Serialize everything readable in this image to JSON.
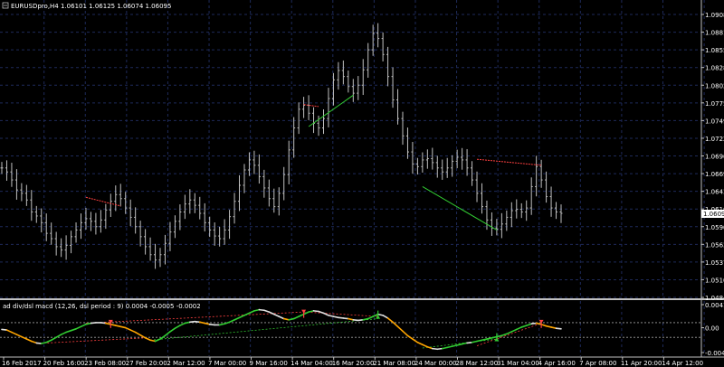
{
  "chart_data": {
    "type": "candlestick",
    "symbol_header": "EURUSDpro,H4  1.06101 1.06125 1.06074 1.06095",
    "current_price": "1.06095",
    "price_axis_ticks": [
      "1.09080",
      "1.08815",
      "1.08550",
      "1.08285",
      "1.08020",
      "1.07755",
      "1.07490",
      "1.07225",
      "1.06960",
      "1.06695",
      "1.06430",
      "1.06165",
      "1.05900",
      "1.05635",
      "1.05370",
      "1.05105",
      "1.04840"
    ],
    "time_axis_labels": [
      "16 Feb 2017",
      "20 Feb 16:00",
      "23 Feb 08:00",
      "27 Feb 20:00",
      "2 Mar 12:00",
      "7 Mar 00:00",
      "9 Mar 16:00",
      "14 Mar 04:00",
      "16 Mar 20:00",
      "21 Mar 08:00",
      "24 Mar 00:00",
      "28 Mar 12:00",
      "31 Mar 04:00",
      "4 Apr 16:00",
      "7 Apr 08:00",
      "11 Apr 20:00",
      "14 Apr 12:00"
    ],
    "price_series_close": [
      1.0678,
      1.0672,
      1.066,
      1.0645,
      1.064,
      1.063,
      1.0612,
      1.0606,
      1.0596,
      1.058,
      1.0572,
      1.056,
      1.0555,
      1.0562,
      1.0575,
      1.0585,
      1.0596,
      1.0602,
      1.0598,
      1.059,
      1.06,
      1.0615,
      1.0628,
      1.0638,
      1.0632,
      1.0618,
      1.0604,
      1.059,
      1.0575,
      1.056,
      1.0548,
      1.054,
      1.0548,
      1.0565,
      1.0582,
      1.0598,
      1.0612,
      1.0624,
      1.063,
      1.0622,
      1.061,
      1.0596,
      1.0585,
      1.0576,
      1.0572,
      1.0585,
      1.0605,
      1.0628,
      1.0652,
      1.0675,
      1.069,
      1.0682,
      1.0665,
      1.0648,
      1.0632,
      1.062,
      1.064,
      1.0668,
      1.0705,
      1.0738,
      1.0766,
      1.0772,
      1.076,
      1.0745,
      1.0738,
      1.0752,
      1.0782,
      1.081,
      1.0824,
      1.0815,
      1.08,
      1.079,
      1.0802,
      1.0825,
      1.0855,
      1.088,
      1.0872,
      1.0848,
      1.0815,
      1.078,
      1.0752,
      1.0726,
      1.0702,
      1.0684,
      1.068,
      1.069,
      1.0692,
      1.0686,
      1.0678,
      1.0672,
      1.0678,
      1.0688,
      1.0694,
      1.069,
      1.0678,
      1.066,
      1.064,
      1.062,
      1.06,
      1.0588,
      1.0586,
      1.0594,
      1.0604,
      1.0614,
      1.0616,
      1.0612,
      1.0618,
      1.065,
      1.068,
      1.066,
      1.0635,
      1.0618,
      1.0612,
      1.061
    ],
    "price_divergence_lines": [
      {
        "color": "#ff4040",
        "from": [
          17,
          1.0634
        ],
        "to": [
          24,
          1.0621
        ]
      },
      {
        "color": "#ff4040",
        "from": [
          61,
          1.0773
        ],
        "to": [
          64,
          1.077
        ]
      },
      {
        "color": "#32cd32",
        "from": [
          62,
          1.074
        ],
        "to": [
          71,
          1.0787
        ]
      },
      {
        "color": "#ff4040",
        "from": [
          96,
          1.0691
        ],
        "to": [
          109,
          1.0682
        ]
      },
      {
        "color": "#32cd32",
        "from": [
          85,
          1.065
        ],
        "to": [
          100,
          1.0585
        ]
      }
    ],
    "indicator_header": "ad div/dsl macd (12,26, dsl period : 9) 0.0004 -0.0005 -0.0002",
    "indicator_axis_ticks": [
      "0.0041",
      "0.00",
      "-0.0044"
    ],
    "indicator_series": [
      -0.0003,
      -0.0004,
      -0.0008,
      -0.0012,
      -0.0016,
      -0.002,
      -0.0024,
      -0.0027,
      -0.0028,
      -0.0026,
      -0.0022,
      -0.0017,
      -0.0012,
      -0.0008,
      -0.0005,
      -0.0002,
      0.0002,
      0.0006,
      0.0008,
      0.0009,
      0.0009,
      0.0008,
      0.0006,
      0.0004,
      0.0002,
      0.0,
      -0.0004,
      -0.0008,
      -0.0013,
      -0.0018,
      -0.0022,
      -0.0024,
      -0.002,
      -0.0014,
      -0.0007,
      -0.0001,
      0.0004,
      0.0008,
      0.001,
      0.0011,
      0.001,
      0.0008,
      0.0006,
      0.0005,
      0.0005,
      0.0007,
      0.001,
      0.0014,
      0.0018,
      0.0022,
      0.0026,
      0.003,
      0.0032,
      0.0031,
      0.0028,
      0.0024,
      0.002,
      0.0016,
      0.0014,
      0.0016,
      0.002,
      0.0024,
      0.0028,
      0.003,
      0.0029,
      0.0026,
      0.0022,
      0.002,
      0.0018,
      0.0017,
      0.0016,
      0.0014,
      0.0013,
      0.0014,
      0.0016,
      0.002,
      0.0024,
      0.0022,
      0.0017,
      0.001,
      0.0002,
      -0.0006,
      -0.0014,
      -0.002,
      -0.0026,
      -0.003,
      -0.0034,
      -0.0037,
      -0.0038,
      -0.0037,
      -0.0035,
      -0.0033,
      -0.0031,
      -0.0029,
      -0.0027,
      -0.0026,
      -0.0024,
      -0.0022,
      -0.002,
      -0.0018,
      -0.0016,
      -0.0014,
      -0.0011,
      -0.0007,
      -0.0003,
      0.0001,
      0.0004,
      0.0007,
      0.0008,
      0.0006,
      0.0003,
      0.0001,
      -0.0001,
      -0.0002
    ],
    "indicator_divergence_lines": [
      {
        "color": "#ff4040",
        "from": [
          17,
          0.0008
        ],
        "to": [
          61,
          0.0028
        ]
      },
      {
        "color": "#ff4040",
        "from": [
          61,
          0.0028
        ],
        "to": [
          76,
          0.002
        ]
      },
      {
        "color": "#ff4040",
        "from": [
          96,
          -0.0032
        ],
        "to": [
          109,
          0.0008
        ]
      },
      {
        "color": "#ff4040",
        "from": [
          7,
          -0.0028
        ],
        "to": [
          29,
          -0.0018
        ]
      },
      {
        "color": "#32cd32",
        "from": [
          85,
          -0.0036
        ],
        "to": [
          100,
          -0.002
        ]
      },
      {
        "color": "#32cd32",
        "from": [
          30,
          -0.0022
        ],
        "to": [
          76,
          0.0016
        ]
      }
    ],
    "indicator_arrows": [
      {
        "index": 22,
        "color": "#ff4040",
        "dir": "down"
      },
      {
        "index": 61,
        "color": "#ff4040",
        "dir": "down"
      },
      {
        "index": 76,
        "color": "#32cd32",
        "dir": "up"
      },
      {
        "index": 100,
        "color": "#32cd32",
        "dir": "up"
      },
      {
        "index": 109,
        "color": "#ff4040",
        "dir": "down"
      }
    ],
    "colors": {
      "background": "#000000",
      "grid": "#1e2a5a",
      "bars": "#c0c0c0",
      "separator": "#c0c0c0",
      "macd_up": "#32cd32",
      "macd_down": "#ffa500",
      "macd_neutral": "#e0e0e0",
      "level_line": "#a0a0a0",
      "price_label_bg": "#ffffff",
      "price_label_fg": "#000000"
    },
    "ylim_price": [
      1.0484,
      1.0908
    ],
    "ylim_indicator": [
      -0.0044,
      0.0041
    ]
  }
}
